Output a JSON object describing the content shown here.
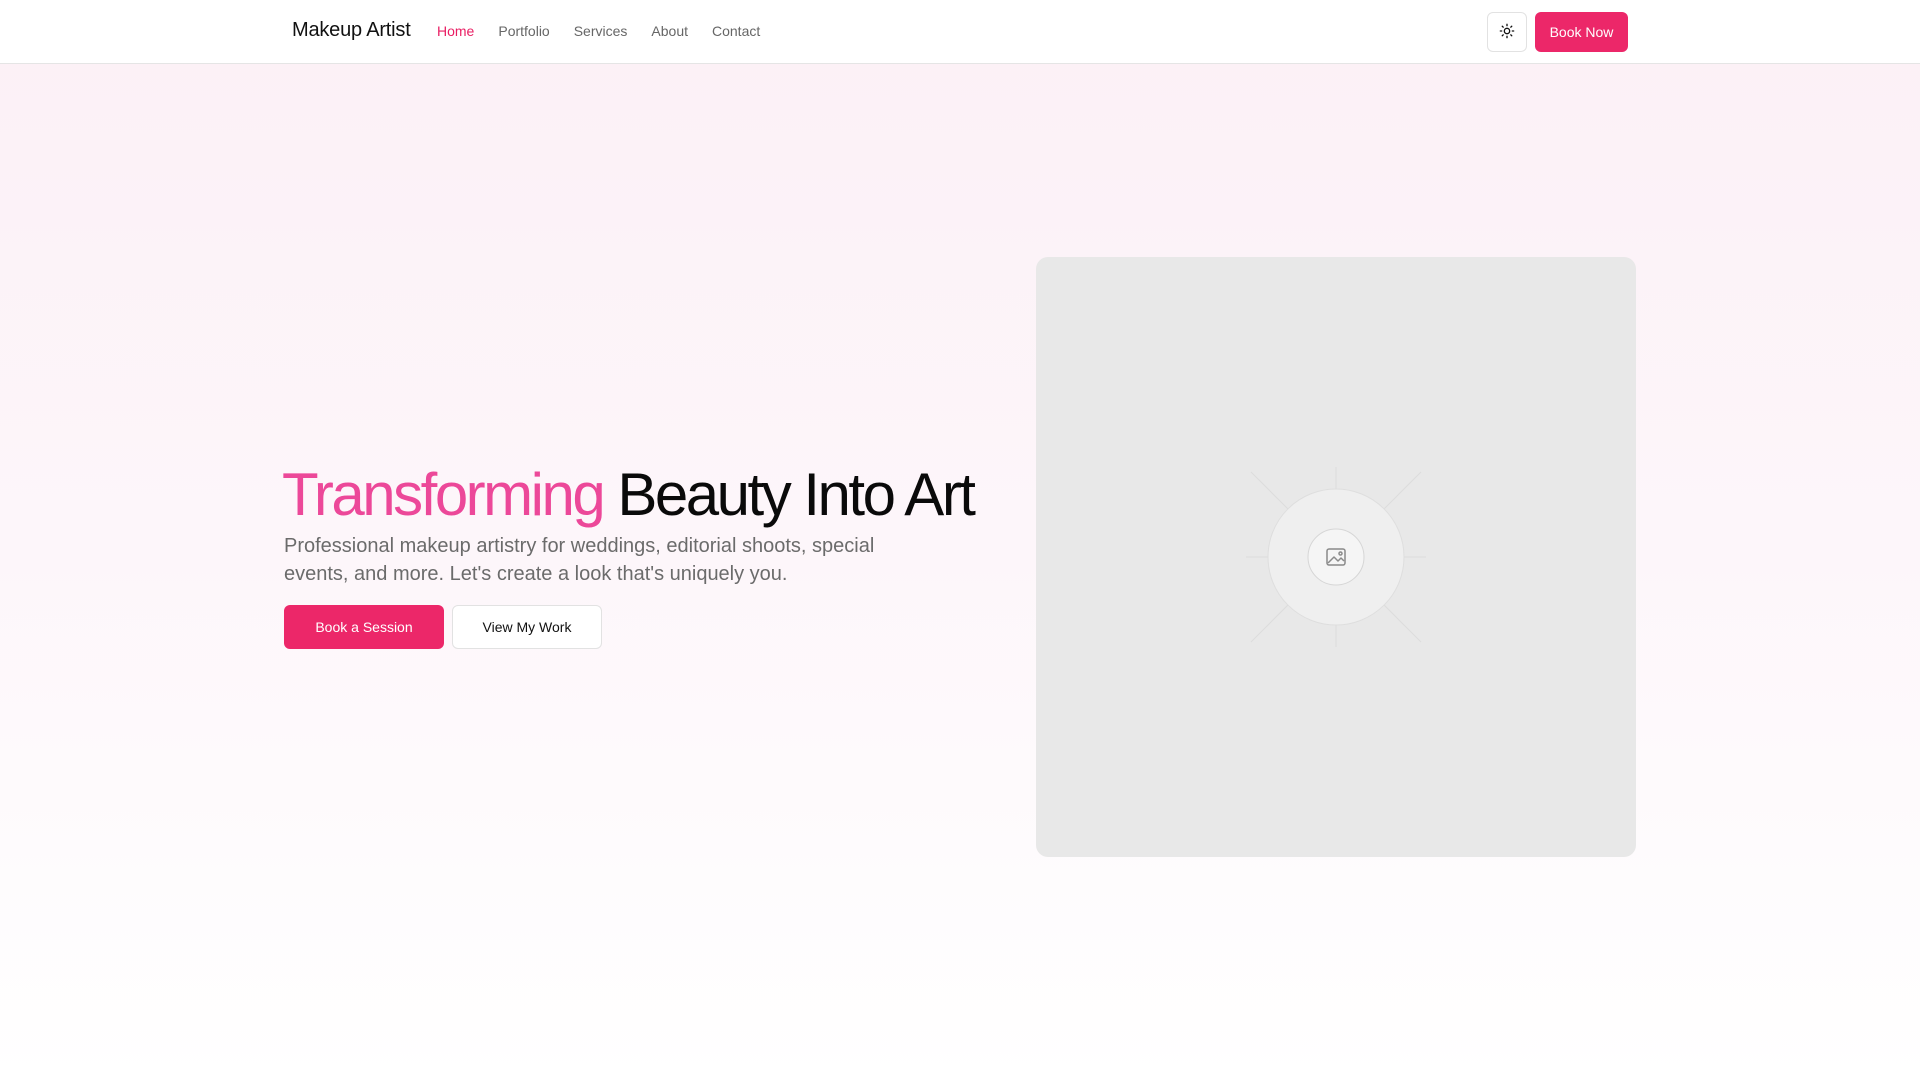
{
  "nav": {
    "brand": "Makeup Artist",
    "links": [
      {
        "label": "Home",
        "active": true
      },
      {
        "label": "Portfolio",
        "active": false
      },
      {
        "label": "Services",
        "active": false
      },
      {
        "label": "About",
        "active": false
      },
      {
        "label": "Contact",
        "active": false
      }
    ],
    "theme_toggle_icon": "sun-icon",
    "cta_label": "Book Now"
  },
  "hero": {
    "title_accent": "Transforming",
    "title_rest": "Beauty Into Art",
    "subtitle": "Professional makeup artistry for weddings, editorial shoots, special events, and more. Let's create a look that's uniquely you.",
    "primary_button": "Book a Session",
    "secondary_button": "View My Work",
    "image_icon": "image-icon"
  },
  "colors": {
    "accent": "#ec2769",
    "accent_text": "#ec4899",
    "placeholder_bg": "#e8e8e8"
  }
}
